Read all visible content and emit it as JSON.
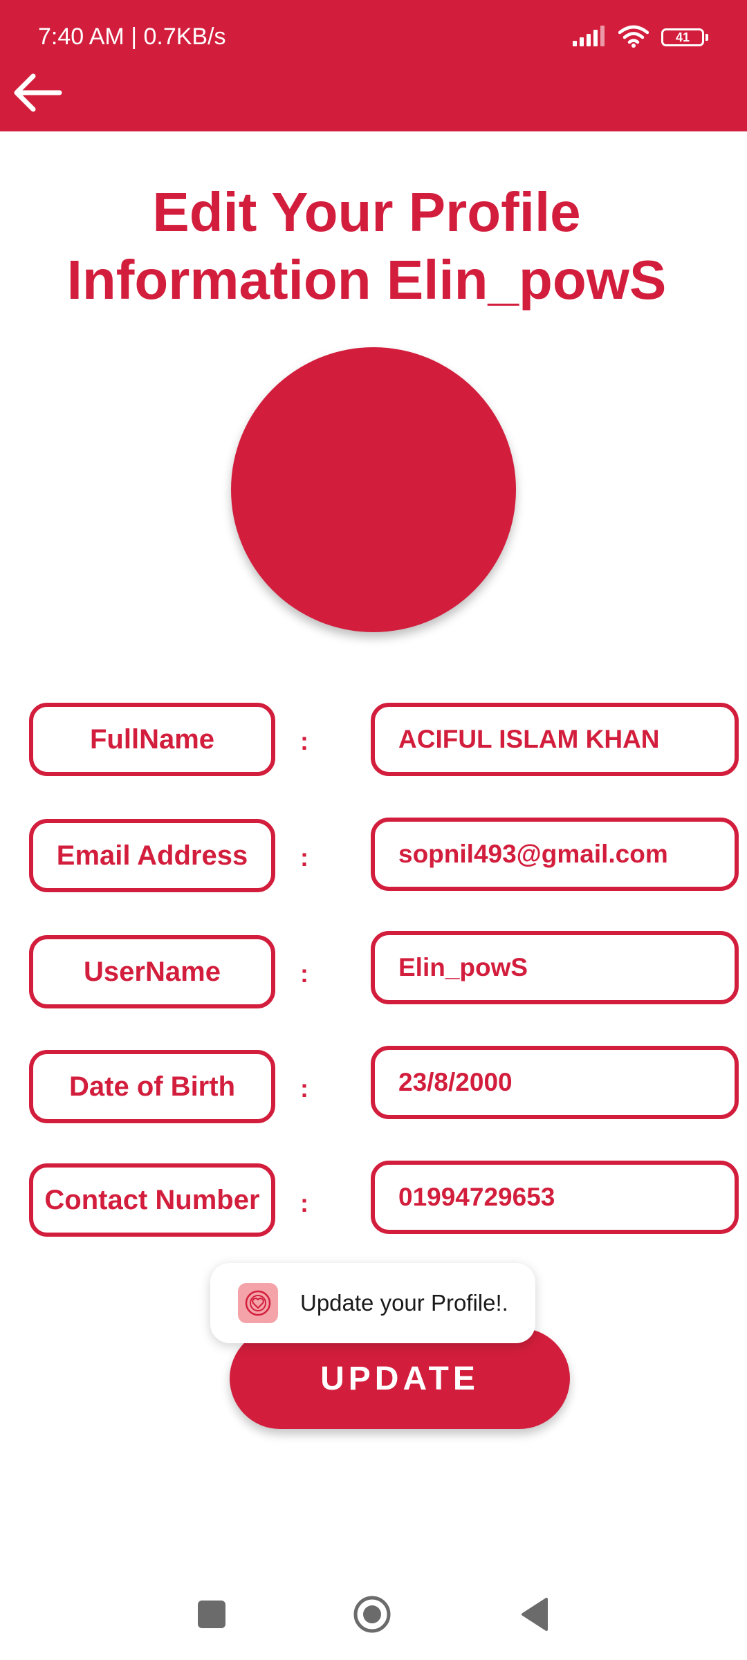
{
  "status_bar": {
    "time_speed": "7:40 AM | 0.7KB/s",
    "battery": "41"
  },
  "colors": {
    "accent": "#D21E3C",
    "background": "#FFFFFF",
    "toast_icon_bg": "#F4A3A8"
  },
  "header": {
    "back_icon": "arrow-left-icon"
  },
  "page": {
    "title": "Edit Your Profile\nInformation  Elin_powS"
  },
  "form": {
    "separator": ":",
    "fields": [
      {
        "label": "FullName",
        "value": "ACIFUL ISLAM KHAN"
      },
      {
        "label": "Email Address",
        "value": "sopnil493@gmail.com"
      },
      {
        "label": "UserName",
        "value": "Elin_powS"
      },
      {
        "label": "Date of Birth",
        "value": "23/8/2000"
      },
      {
        "label": "Contact Number",
        "value": "01994729653"
      }
    ]
  },
  "actions": {
    "update_label": "UPDATE"
  },
  "toast": {
    "message": "Update your Profile!.",
    "icon": "heart-app-icon"
  },
  "navbar": {
    "recents_icon": "square-icon",
    "home_icon": "circle-icon",
    "back_icon": "triangle-back-icon"
  }
}
